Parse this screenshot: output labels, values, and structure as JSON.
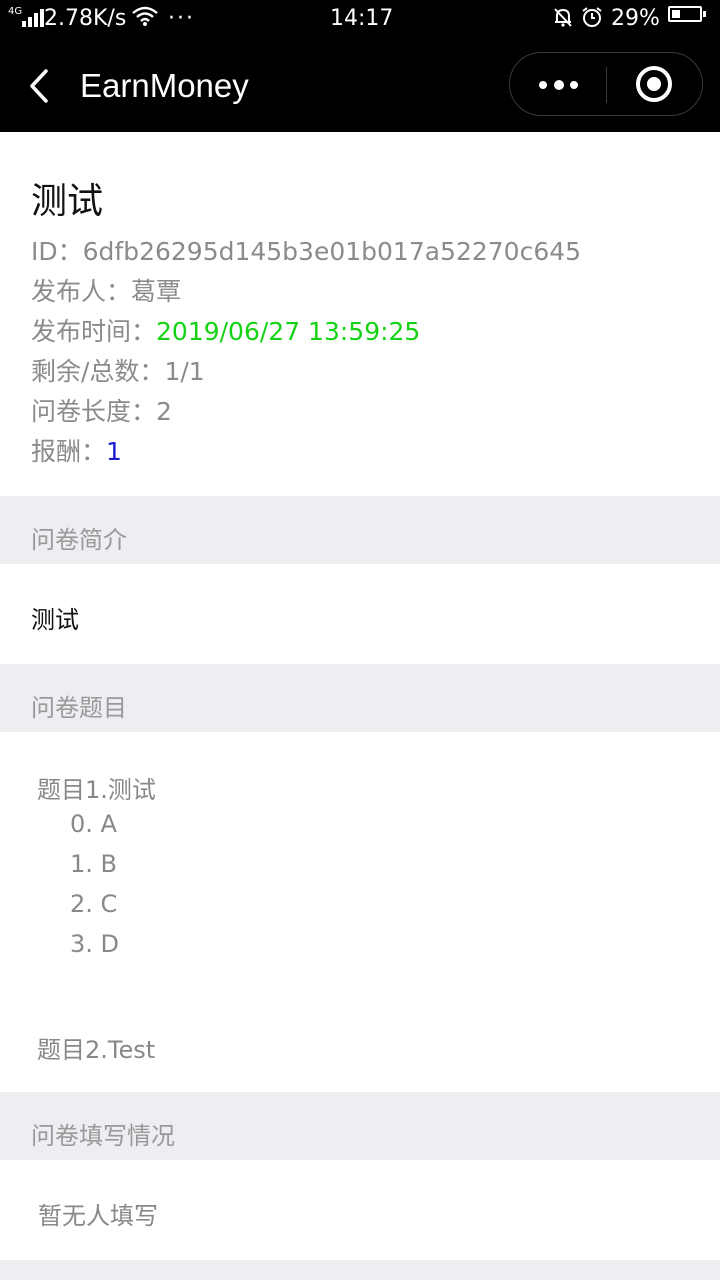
{
  "status_bar": {
    "network": "4G",
    "speed": "2.78K/s",
    "more": "···",
    "time": "14:17",
    "battery_pct": "29%",
    "battery_level": 0.29
  },
  "nav": {
    "title": "EarnMoney"
  },
  "info": {
    "title": "测试",
    "id_label": "ID：",
    "id_value": "6dfb26295d145b3e01b017a52270c645",
    "publisher_label": "发布人：",
    "publisher_value": "葛覃",
    "time_label": "发布时间：",
    "time_value": "2019/06/27 13:59:25",
    "remaining_label": "剩余/总数：",
    "remaining_value": "1/1",
    "length_label": "问卷长度：",
    "length_value": "2",
    "reward_label": "报酬：",
    "reward_value": "1"
  },
  "sections": {
    "intro_header": "问卷简介",
    "intro_text": "测试",
    "questions_header": "问卷题目",
    "fill_header": "问卷填写情况",
    "fill_empty": "暂无人填写"
  },
  "questions": [
    {
      "title": "题目1.测试",
      "options": [
        "0. A",
        "1. B",
        "2. C",
        "3. D"
      ]
    },
    {
      "title": "题目2.Test",
      "options": []
    }
  ]
}
